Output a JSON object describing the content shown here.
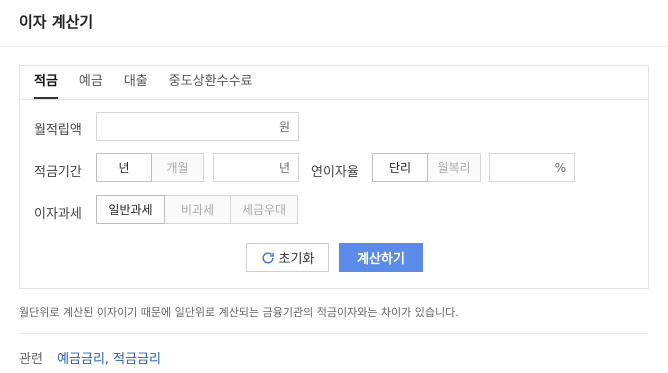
{
  "header": {
    "title": "이자 계산기"
  },
  "tabs": [
    {
      "label": "적금",
      "active": true
    },
    {
      "label": "예금",
      "active": false
    },
    {
      "label": "대출",
      "active": false
    },
    {
      "label": "중도상환수수료",
      "active": false
    }
  ],
  "form": {
    "monthly_deposit": {
      "label": "월적립액",
      "value": "",
      "unit": "원"
    },
    "period": {
      "label": "적금기간",
      "options": [
        "년",
        "개월"
      ],
      "selected": "년",
      "value": "",
      "unit": "년"
    },
    "rate": {
      "label": "연이자율",
      "options": [
        "단리",
        "월복리"
      ],
      "selected": "단리",
      "value": "",
      "unit": "%"
    },
    "tax": {
      "label": "이자과세",
      "options": [
        "일반과세",
        "비과세",
        "세금우대"
      ],
      "selected": "일반과세"
    }
  },
  "actions": {
    "reset_label": "초기화",
    "calc_label": "계산하기"
  },
  "note": "월단위로 계산된 이자이기 때문에 일단위로 계산되는 금융기관의 적금이자와는 차이가 있습니다.",
  "related": {
    "label": "관련",
    "links": [
      "예금금리",
      "적금금리"
    ],
    "separator": ", "
  },
  "colors": {
    "primary_button": "#5a8be8",
    "link": "#2a5fb0"
  }
}
